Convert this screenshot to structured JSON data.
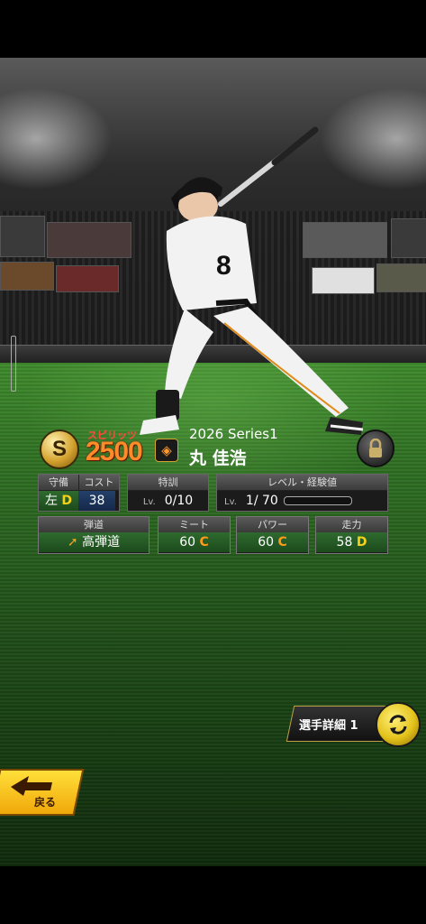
{
  "card": {
    "rarity_badge": "S",
    "spirits_label": "スピリッツ",
    "spirits_value": "2500",
    "series": "2026 Series1",
    "player_name": "丸 佳浩",
    "uniform_number": "8"
  },
  "stats": {
    "position": {
      "label": "守備",
      "value": "左",
      "grade": "D"
    },
    "cost": {
      "label": "コスト",
      "value": "38"
    },
    "special_training": {
      "label": "特訓",
      "lv_prefix": "Lv.",
      "value": "0/10"
    },
    "level_exp": {
      "label": "レベル・経験値",
      "lv_prefix": "Lv.",
      "value": "1/ 70",
      "exp_fraction": 0.0
    },
    "trajectory": {
      "label": "弾道",
      "value": "高弾道"
    },
    "meet": {
      "label": "ミート",
      "value": "60",
      "grade": "C"
    },
    "power": {
      "label": "パワー",
      "value": "60",
      "grade": "C"
    },
    "speed": {
      "label": "走力",
      "value": "58",
      "grade": "D"
    }
  },
  "buttons": {
    "detail_label": "選手詳細 1",
    "back_label": "戻る"
  },
  "colors": {
    "grade_c": "#ff9a1a",
    "grade_d": "#f4d21a",
    "spirits": "#ff8a2a",
    "accent_gold": "#e3c21a"
  },
  "icons": [
    "s-rank-icon",
    "team-emblem-icon",
    "lock-icon",
    "refresh-icon",
    "trajectory-arrow-icon",
    "back-arrow-icon"
  ]
}
